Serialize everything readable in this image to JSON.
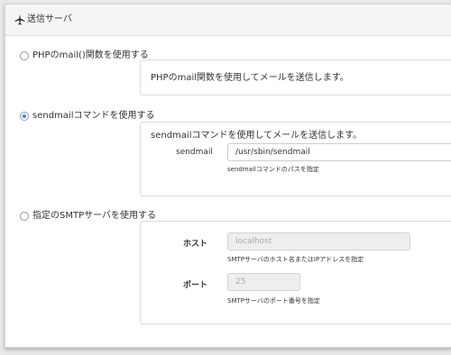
{
  "panel": {
    "title": "送信サーバ",
    "icon": "plane-icon"
  },
  "options": [
    {
      "label": "PHPのmail()関数を使用する",
      "checked": false
    },
    {
      "label": "sendmailコマンドを使用する",
      "checked": true
    },
    {
      "label": "指定のSMTPサーバを使用する",
      "checked": false
    }
  ],
  "php_box": {
    "text": "PHPのmail関数を使用してメールを送信します。"
  },
  "sendmail_box": {
    "text": "sendmailコマンドを使用してメールを送信します。",
    "path_label": "sendmail",
    "path_value": "/usr/sbin/sendmail",
    "path_help": "sendmailコマンドのパスを指定"
  },
  "smtp_box": {
    "host_label": "ホスト",
    "host_placeholder": "localhost",
    "host_help": "SMTPサーバのホスト名またはIPアドレスを指定",
    "port_label": "ポート",
    "port_placeholder": "25",
    "port_help": "SMTPサーバのポート番号を指定"
  }
}
